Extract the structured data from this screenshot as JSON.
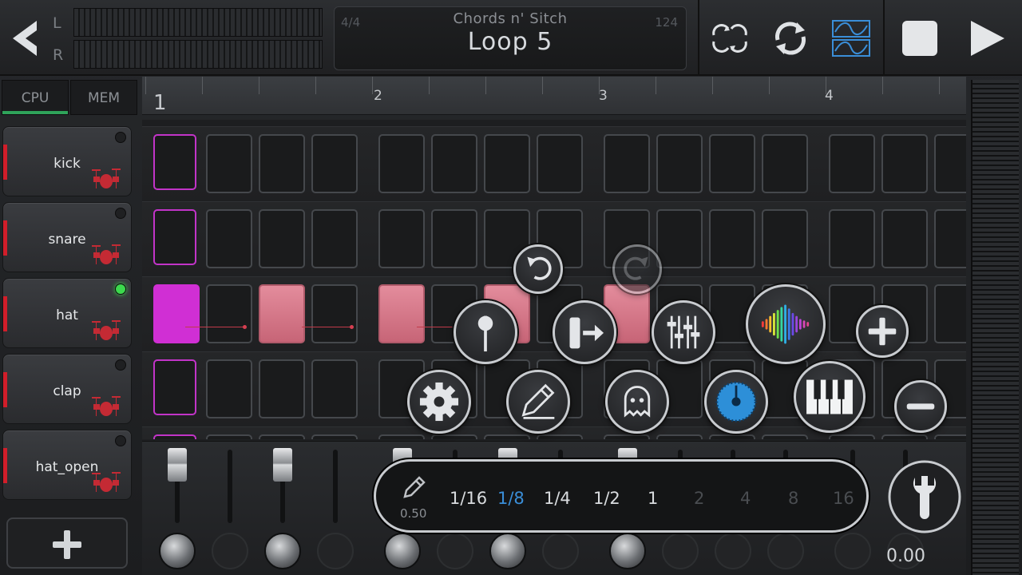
{
  "topbar": {
    "left_label": "L",
    "right_label": "R",
    "time_signature": "4/4",
    "tempo": "124",
    "song_name": "Chords n' Sitch",
    "loop_name": "Loop 5"
  },
  "stats": {
    "cpu_label": "CPU",
    "mem_label": "MEM",
    "cpu_level": 1.0,
    "mem_level": 0.0
  },
  "tracks": [
    {
      "name": "kick",
      "led": "off"
    },
    {
      "name": "snare",
      "led": "off"
    },
    {
      "name": "hat",
      "led": "on"
    },
    {
      "name": "clap",
      "led": "off"
    },
    {
      "name": "hat_open",
      "led": "off"
    }
  ],
  "timeline": {
    "bars": [
      "1",
      "2",
      "3",
      "4"
    ]
  },
  "quantize": {
    "pencil_value": "0.50",
    "options": [
      "1/16",
      "1/8",
      "1/4",
      "1/2",
      "1",
      "2",
      "4",
      "8",
      "16"
    ],
    "selected": "1/8"
  },
  "mixer": {
    "master_value": "0.00"
  },
  "colors": {
    "accent_blue": "#3a8ed8",
    "step_on": "#d02fd4",
    "step_note": "#d9788a",
    "led_on": "#3cd94d",
    "track_marker": "#d11e2a"
  },
  "icons": {
    "back": "back-arrow-icon",
    "link": "link-loops-icon",
    "loop": "loop-icon",
    "wave": "wave-edit-icon",
    "stop": "stop-icon",
    "play": "play-icon",
    "undo": "undo-icon",
    "redo": "redo-icon",
    "velocity": "velocity-icon",
    "length": "note-length-icon",
    "mixer": "mixer-sliders-icon",
    "waveform": "waveform-icon",
    "add": "add-icon",
    "remove": "remove-icon",
    "settings": "gear-icon",
    "edit": "pencil-icon",
    "ghost": "ghost-icon",
    "tempo": "tempo-dial-icon",
    "piano": "piano-icon",
    "wrench": "wrench-icon"
  }
}
